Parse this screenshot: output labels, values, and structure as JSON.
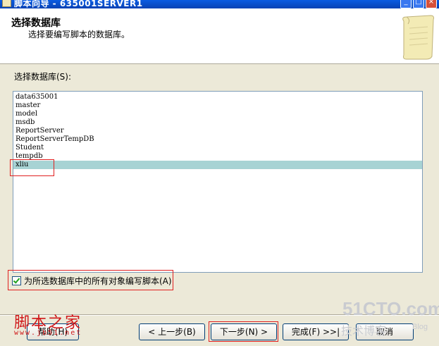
{
  "window": {
    "title": "脚本向导 - 635001SERVER1",
    "minimize": "_",
    "maximize": "□",
    "close": "×"
  },
  "header": {
    "title": "选择数据库",
    "subtitle": "选择要编写脚本的数据库。"
  },
  "db_label": "选择数据库(S):",
  "databases": [
    "data635001",
    "master",
    "model",
    "msdb",
    "ReportServer",
    "ReportServerTempDB",
    "Student",
    "tempdb",
    "xliu"
  ],
  "selected_database": "xliu",
  "checkbox": {
    "label": "为所选数据库中的所有对象编写脚本(A)",
    "checked": true
  },
  "buttons": {
    "help": "帮助(H)",
    "back": "< 上一步(B)",
    "next": "下一步(N) >",
    "finish": "完成(F) >>|",
    "cancel": "取消"
  },
  "watermarks": {
    "left": "脚本之家",
    "left_url": "www.jb51.net",
    "right": "51CTO.com",
    "right_sub": "技术博客",
    "right_blog": "Blog"
  }
}
